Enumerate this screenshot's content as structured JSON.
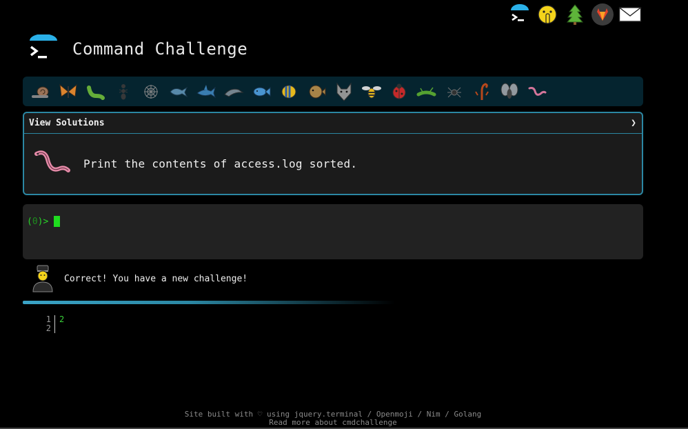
{
  "header": {
    "title": "Command Challenge"
  },
  "top_icons": [
    "terminal-umbrella-icon",
    "shushing-face-icon",
    "tree-icon",
    "gitlab-icon",
    "mail-icon"
  ],
  "strip_icons": [
    "snail-icon",
    "butterfly-icon",
    "caterpillar-icon",
    "ant-icon",
    "spider-web-icon",
    "whale-icon",
    "shark-icon",
    "dolphin-icon",
    "fish-icon",
    "tropical-fish-icon",
    "blowfish-icon",
    "wolf-icon",
    "bee-icon",
    "ladybug-icon",
    "cricket-icon",
    "spider-icon",
    "scorpion-icon",
    "fly-icon",
    "worm-icon"
  ],
  "challenge": {
    "solutions_label": "View Solutions",
    "chevron": "❯",
    "text": "Print the contents of access.log sorted."
  },
  "terminal": {
    "prompt_prefix": "(",
    "prompt_num": "0",
    "prompt_suffix": ")>"
  },
  "feedback": {
    "text": "Correct! You have a new challenge!"
  },
  "output": {
    "lines": [
      {
        "num": "1",
        "value": "2"
      },
      {
        "num": "2",
        "value": ""
      }
    ]
  },
  "footer": {
    "line1": "Site built with ♡ using jquery.terminal / Openmoji / Nim / Golang",
    "line2": "Read more about cmdchallenge"
  },
  "colors": {
    "accent": "#2b87a3",
    "strip_bg": "#05242f",
    "prompt_green": "#29d329"
  }
}
